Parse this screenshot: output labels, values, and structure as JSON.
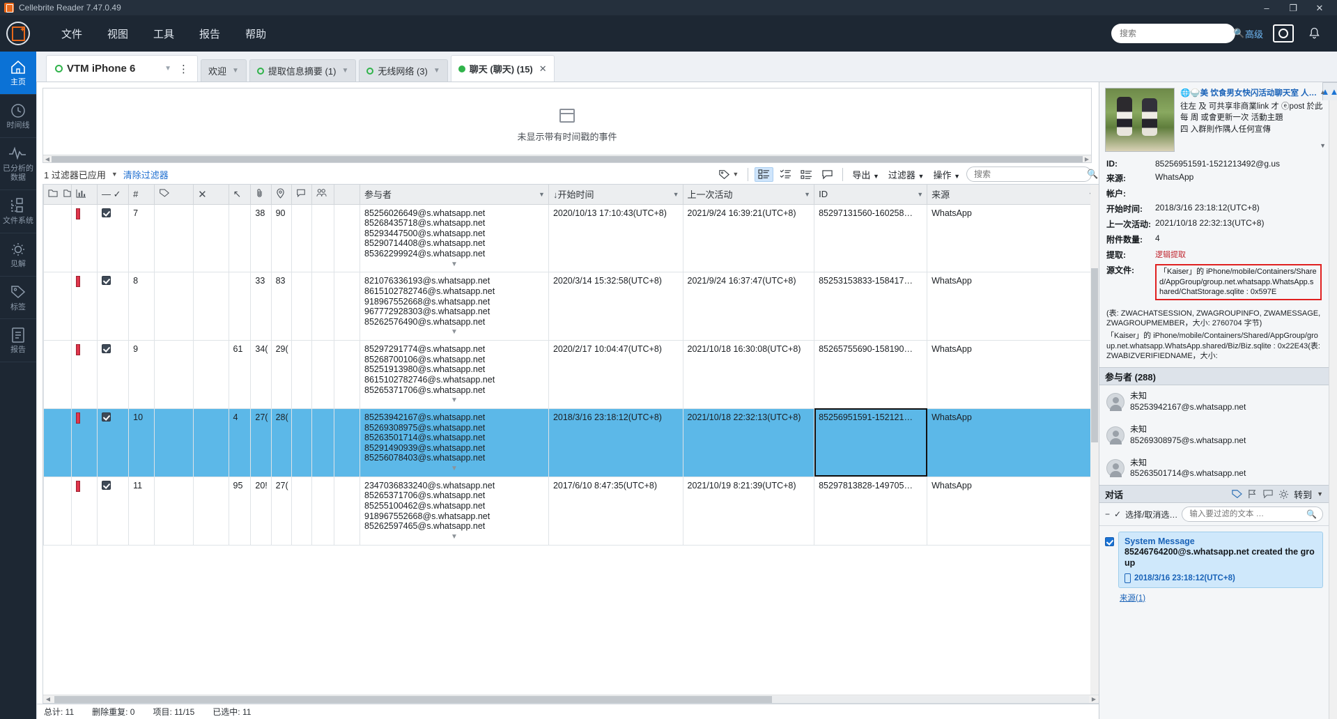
{
  "titlebar": {
    "app_title": "Cellebrite Reader 7.47.0.49",
    "minimize": "–",
    "maximize": "❐",
    "close": "✕"
  },
  "menubar": {
    "items": [
      "文件",
      "视图",
      "工具",
      "报告",
      "帮助"
    ],
    "search_placeholder": "搜索",
    "search_value": "",
    "advanced_label": "高级"
  },
  "rail": {
    "items": [
      {
        "label": "主页",
        "icon": "home-icon",
        "active": true
      },
      {
        "label": "时间线",
        "icon": "clock-icon",
        "active": false
      },
      {
        "label": "已分析的数据",
        "icon": "waveform-icon",
        "active": false
      },
      {
        "label": "文件系统",
        "icon": "filesystem-icon",
        "active": false
      },
      {
        "label": "见解",
        "icon": "lightbulb-icon",
        "active": false
      },
      {
        "label": "标签",
        "icon": "tag-icon",
        "active": false
      },
      {
        "label": "报告",
        "icon": "report-icon",
        "active": false
      }
    ]
  },
  "tabs": {
    "device": {
      "name": "VTM iPhone 6",
      "status": "green-ring"
    },
    "items": [
      {
        "label": "欢迎",
        "active": false,
        "dot": false
      },
      {
        "label": "提取信息摘要 (1)",
        "active": false,
        "dot": true
      },
      {
        "label": "无线网络 (3)",
        "active": false,
        "dot": true
      },
      {
        "label": "聊天 (聊天) (15)",
        "active": true,
        "dot": true
      }
    ]
  },
  "timeline": {
    "empty_text": "未显示带有时间戳的事件"
  },
  "filterbar": {
    "applied_text": "1 过滤器已应用",
    "clear_label": "清除过滤器",
    "export_label": "导出",
    "filter_label": "过滤器",
    "action_label": "操作",
    "search_placeholder": "搜索",
    "search_value": ""
  },
  "grid": {
    "columns": [
      {
        "key": "folder",
        "label": "",
        "icon": "folder-icons"
      },
      {
        "key": "bar",
        "label": "",
        "icon": "chart-icon"
      },
      {
        "key": "check",
        "label": "",
        "icon": "dash-check-icon"
      },
      {
        "key": "num",
        "label": "#"
      },
      {
        "key": "tag",
        "label": "",
        "icon": "tag-icon"
      },
      {
        "key": "x",
        "label": "",
        "icon": "x-icon"
      },
      {
        "key": "arrow",
        "label": "",
        "icon": "arrow-icon"
      },
      {
        "key": "attach",
        "label": "",
        "icon": "paperclip-icon"
      },
      {
        "key": "loc",
        "label": "",
        "icon": "location-icon"
      },
      {
        "key": "chat",
        "label": "",
        "icon": "chat-icon"
      },
      {
        "key": "people",
        "label": "",
        "icon": "people-icon"
      },
      {
        "key": "participants",
        "label": "参与者"
      },
      {
        "key": "start",
        "label": "开始时间",
        "sorted": "asc"
      },
      {
        "key": "last",
        "label": "上一次活动"
      },
      {
        "key": "id",
        "label": "ID"
      },
      {
        "key": "source",
        "label": "来源"
      }
    ],
    "rows": [
      {
        "checked": true,
        "flag": true,
        "num": "7",
        "c_arrow": "",
        "c_attach": "38",
        "c_loc": "90",
        "participants": [
          "85256026649@s.whatsapp.net",
          "85268435718@s.whatsapp.net",
          "85293447500@s.whatsapp.net",
          "85290714408@s.whatsapp.net",
          "85362299924@s.whatsapp.net"
        ],
        "start": "2020/10/13 17:10:43(UTC+8)",
        "last": "2021/9/24 16:39:21(UTC+8)",
        "id": "85297131560-160258…",
        "source": "WhatsApp",
        "selected": false
      },
      {
        "checked": true,
        "flag": true,
        "num": "8",
        "c_arrow": "",
        "c_attach": "33",
        "c_loc": "83",
        "participants": [
          "821076336193@s.whatsapp.net",
          "8615102782746@s.whatsapp.net",
          "918967552668@s.whatsapp.net",
          "967772928303@s.whatsapp.net",
          "85262576490@s.whatsapp.net"
        ],
        "start": "2020/3/14 15:32:58(UTC+8)",
        "last": "2021/9/24 16:37:47(UTC+8)",
        "id": "85253153833-158417…",
        "source": "WhatsApp",
        "selected": false
      },
      {
        "checked": true,
        "flag": true,
        "num": "9",
        "c_arrow": "61",
        "c_attach": "34(",
        "c_loc": "29(",
        "participants": [
          "85297291774@s.whatsapp.net",
          "85268700106@s.whatsapp.net",
          "85251913980@s.whatsapp.net",
          "8615102782746@s.whatsapp.net",
          "85265371706@s.whatsapp.net"
        ],
        "start": "2020/2/17 10:04:47(UTC+8)",
        "last": "2021/10/18 16:30:08(UTC+8)",
        "id": "85265755690-158190…",
        "source": "WhatsApp",
        "selected": false
      },
      {
        "checked": true,
        "flag": true,
        "num": "10",
        "c_arrow": "4",
        "c_attach": "27(",
        "c_loc": "28(",
        "participants": [
          "85253942167@s.whatsapp.net",
          "85269308975@s.whatsapp.net",
          "85263501714@s.whatsapp.net",
          "85291490939@s.whatsapp.net",
          "85256078403@s.whatsapp.net"
        ],
        "start": "2018/3/16 23:18:12(UTC+8)",
        "last": "2021/10/18 22:32:13(UTC+8)",
        "id": "85256951591-152121…",
        "source": "WhatsApp",
        "selected": true
      },
      {
        "checked": true,
        "flag": true,
        "num": "11",
        "c_arrow": "95",
        "c_attach": "20!",
        "c_loc": "27(",
        "participants": [
          "2347036833240@s.whatsapp.net",
          "85265371706@s.whatsapp.net",
          "85255100462@s.whatsapp.net",
          "918967552668@s.whatsapp.net",
          "85262597465@s.whatsapp.net"
        ],
        "start": "2017/6/10 8:47:35(UTC+8)",
        "last": "2021/10/19 8:21:39(UTC+8)",
        "id": "85297813828-149705…",
        "source": "WhatsApp",
        "selected": false
      }
    ]
  },
  "status": {
    "total": "总计: 11",
    "dedup": "删除重复: 0",
    "items": "项目: 11/15",
    "selected": "已选中: 11"
  },
  "detail": {
    "header_title": "🌐🍚美 饮食男女快闪活动聊天室 人…",
    "header_lines": [
      "往左 及 可共享非商業link 才",
      "ⓔpost 於此",
      "每 周 或會更新一次 活動主題",
      "四 入群則作隅人任何宣傳"
    ],
    "fields": [
      {
        "key": "ID:",
        "value": "85256951591-1521213492@g.us"
      },
      {
        "key": "来源:",
        "value": "WhatsApp"
      },
      {
        "key": "帐户:",
        "value": ""
      },
      {
        "key": "开始时间:",
        "value": "2018/3/16 23:18:12(UTC+8)"
      },
      {
        "key": "上一次活动:",
        "value": "2021/10/18 22:32:13(UTC+8)"
      },
      {
        "key": "附件数量:",
        "value": "4"
      },
      {
        "key": "提取:",
        "value": "逻辑提取",
        "red": true
      },
      {
        "key": "源文件:",
        "value": "",
        "boxed": true
      }
    ],
    "source_box": "「Kaiser」的 iPhone/mobile/Containers/Shared/AppGroup/group.net.whatsapp.WhatsApp.shared/ChatStorage.sqlite : 0x597E",
    "source_extra": [
      "(表: ZWACHATSESSION, ZWAGROUPINFO, ZWAMESSAGE, ZWAGROUPMEMBER，大小: 2760704 字节)",
      "「Kaiser」的 iPhone/mobile/Containers/Shared/AppGroup/group.net.whatsapp.WhatsApp.shared/Biz/Biz.sqlite : 0x22E43(表: ZWABIZVERIFIEDNAME，大小:"
    ],
    "participants_header": "参与者 (288)",
    "participants": [
      {
        "name": "未知",
        "id": "85253942167@s.whatsapp.net"
      },
      {
        "name": "未知",
        "id": "85269308975@s.whatsapp.net"
      },
      {
        "name": "未知",
        "id": "85263501714@s.whatsapp.net"
      }
    ],
    "conversation_header": "对话",
    "goto_label": "转到",
    "select_toggle": "选择/取消选…",
    "conv_search_placeholder": "输入要过滤的文本 …",
    "conv_search_value": "",
    "message": {
      "sender": "System Message",
      "body": "85246764200@s.whatsapp.net created the group",
      "timestamp": "2018/3/16 23:18:12(UTC+8)",
      "source_link": "来源(1)",
      "checked": true
    }
  },
  "colors": {
    "accent": "#0b72d6",
    "brand_orange": "#e8681a",
    "dark_chrome": "#1d2733",
    "selection_blue": "#5cb8e8",
    "link_blue": "#1f6fd0",
    "status_green": "#30b34a",
    "alert_red": "#e02020"
  }
}
